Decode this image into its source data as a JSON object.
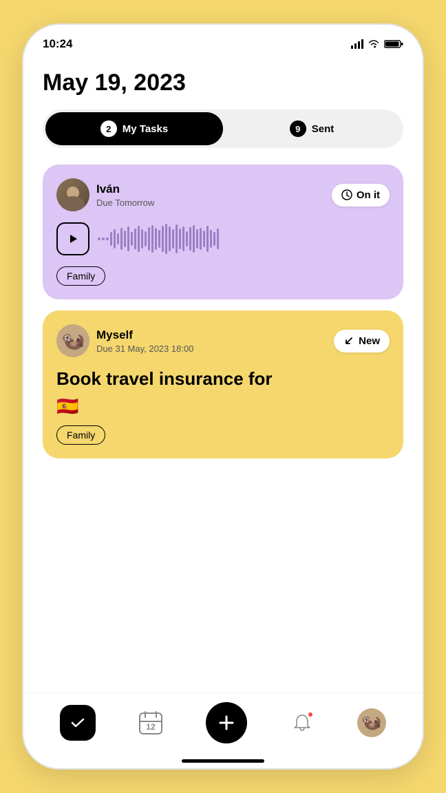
{
  "statusBar": {
    "time": "10:24"
  },
  "header": {
    "date": "May 19, 2023"
  },
  "tabs": {
    "myTasks": {
      "label": "My Tasks",
      "count": "2"
    },
    "sent": {
      "label": "Sent",
      "count": "9"
    }
  },
  "tasks": [
    {
      "id": "task-1",
      "cardColor": "purple",
      "user": {
        "name": "Iván",
        "due": "Due Tomorrow"
      },
      "status": {
        "label": "On it",
        "icon": "clock"
      },
      "hasAudio": true,
      "tag": "Family"
    },
    {
      "id": "task-2",
      "cardColor": "yellow",
      "user": {
        "name": "Myself",
        "due": "Due 31 May, 2023 18:00"
      },
      "status": {
        "label": "New",
        "icon": "arrow-down-left"
      },
      "taskText": "Book travel insurance for",
      "taskEmoji": "🇪🇸",
      "tag": "Family"
    }
  ],
  "bottomNav": {
    "check": "✓",
    "calendarDay": "12",
    "add": "+",
    "bell": "🔔",
    "avatarEmoji": "🦫"
  }
}
